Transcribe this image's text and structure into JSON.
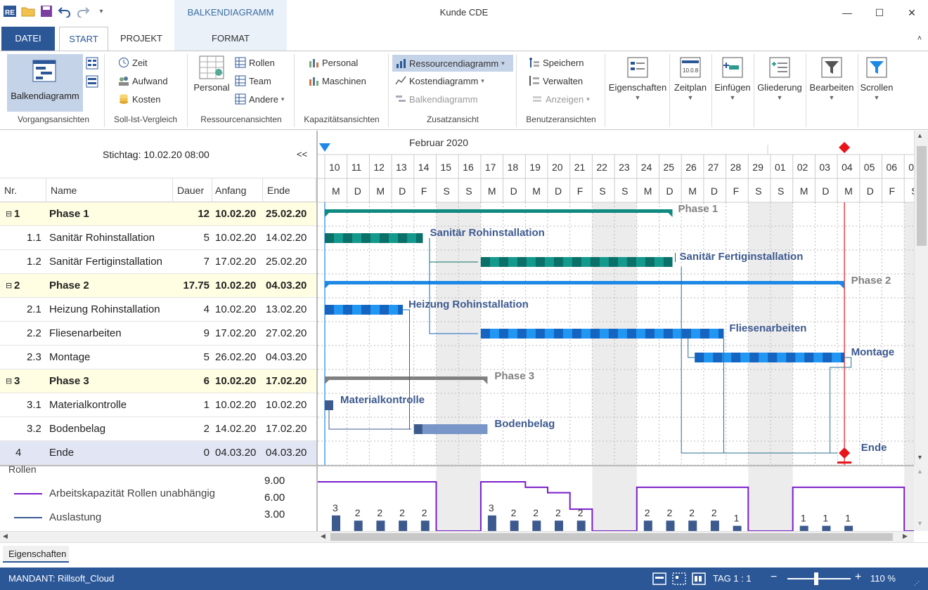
{
  "app": {
    "title": "Kunde CDE",
    "context_tab": "BALKENDIAGRAMM"
  },
  "tabs": [
    "DATEI",
    "START",
    "PROJEKT",
    "FORMAT"
  ],
  "ribbon": {
    "groups": {
      "vorgang": "Vorgangsansichten",
      "sollist": "Soll-Ist-Vergleich",
      "ressourcen": "Ressourcenansichten",
      "kapazitaet": "Kapazitätsansichten",
      "zusatz": "Zusatzansicht",
      "benutzer": "Benutzeransichten"
    },
    "balkendiagramm": "Balkendiagramm",
    "zeit": "Zeit",
    "aufwand": "Aufwand",
    "kosten": "Kosten",
    "personal": "Personal",
    "rollen": "Rollen",
    "team": "Team",
    "andere": "Andere",
    "kap_personal": "Personal",
    "maschinen": "Maschinen",
    "ressourcendiagramm": "Ressourcendiagramm",
    "kostendiagramm": "Kostendiagramm",
    "zusatz_balken": "Balkendiagramm",
    "speichern": "Speichern",
    "verwalten": "Verwalten",
    "anzeigen": "Anzeigen",
    "eigenschaften": "Eigenschaften",
    "zeitplan": "Zeitplan",
    "einfuegen": "Einfügen",
    "gliederung": "Gliederung",
    "bearbeiten": "Bearbeiten",
    "scrollen": "Scrollen",
    "zeitplan_icon_text": "10.0.8"
  },
  "table": {
    "stichtag": "Stichtag: 10.02.20 08:00",
    "collapse": "<<",
    "headers": {
      "nr": "Nr.",
      "name": "Name",
      "dauer": "Dauer",
      "anfang": "Anfang",
      "ende": "Ende"
    },
    "rows": [
      {
        "nr": "1",
        "name": "Phase 1",
        "dauer": "12",
        "anfang": "10.02.20",
        "ende": "25.02.20"
      },
      {
        "nr": "1.1",
        "name": "Sanitär Rohinstallation",
        "dauer": "5",
        "anfang": "10.02.20",
        "ende": "14.02.20"
      },
      {
        "nr": "1.2",
        "name": "Sanitär Fertiginstallation",
        "dauer": "7",
        "anfang": "17.02.20",
        "ende": "25.02.20"
      },
      {
        "nr": "2",
        "name": "Phase 2",
        "dauer": "17.75",
        "anfang": "10.02.20",
        "ende": "04.03.20"
      },
      {
        "nr": "2.1",
        "name": "Heizung Rohinstallation",
        "dauer": "4",
        "anfang": "10.02.20",
        "ende": "13.02.20"
      },
      {
        "nr": "2.2",
        "name": "Fliesenarbeiten",
        "dauer": "9",
        "anfang": "17.02.20",
        "ende": "27.02.20"
      },
      {
        "nr": "2.3",
        "name": "Montage",
        "dauer": "5",
        "anfang": "26.02.20",
        "ende": "04.03.20"
      },
      {
        "nr": "3",
        "name": "Phase 3",
        "dauer": "6",
        "anfang": "10.02.20",
        "ende": "17.02.20"
      },
      {
        "nr": "3.1",
        "name": "Materialkontrolle",
        "dauer": "1",
        "anfang": "10.02.20",
        "ende": "10.02.20"
      },
      {
        "nr": "3.2",
        "name": "Bodenbelag",
        "dauer": "2",
        "anfang": "14.02.20",
        "ende": "17.02.20"
      },
      {
        "nr": "4",
        "name": "Ende",
        "dauer": "0",
        "anfang": "04.03.20",
        "ende": "04.03.20"
      }
    ]
  },
  "timeline": {
    "month": "Februar 2020",
    "days": [
      "10",
      "11",
      "12",
      "13",
      "14",
      "15",
      "16",
      "17",
      "18",
      "19",
      "20",
      "21",
      "22",
      "23",
      "24",
      "25",
      "26",
      "27",
      "28",
      "29",
      "01",
      "02",
      "03",
      "04",
      "05",
      "06",
      "0"
    ],
    "weekdays": [
      "M",
      "D",
      "M",
      "D",
      "F",
      "S",
      "S",
      "M",
      "D",
      "M",
      "D",
      "F",
      "S",
      "S",
      "M",
      "D",
      "M",
      "D",
      "F",
      "S",
      "S",
      "M",
      "D",
      "M",
      "D",
      "F",
      "S"
    ],
    "weekend_days": [
      5,
      6,
      12,
      13,
      19,
      20,
      26
    ]
  },
  "gantt_labels": [
    "Phase 1",
    "Sanitär Rohinstallation",
    "Sanitär Fertiginstallation",
    "Phase 2",
    "Heizung Rohinstallation",
    "Fliesenarbeiten",
    "Montage",
    "Phase 3",
    "Materialkontrolle",
    "Bodenbelag",
    "Ende"
  ],
  "colors": {
    "teal": "#0e8a80",
    "blue": "#1e88e5",
    "gray": "#808080",
    "navy": "#3d5a8f",
    "purple": "#7a1fc9",
    "milestone": "#e8141a"
  },
  "legend": {
    "title": "Rollen",
    "kapazitaet": "Arbeitskapazität Rollen unabhängig",
    "auslastung": "Auslastung"
  },
  "chart_data": {
    "type": "bar",
    "ytick_labels": [
      "9.00",
      "6.00",
      "3.00"
    ],
    "ylim": [
      0,
      9
    ],
    "auslastung_values": [
      3,
      2,
      2,
      2,
      2,
      0,
      0,
      3,
      2,
      2,
      2,
      2,
      0,
      0,
      2,
      2,
      2,
      2,
      1,
      0,
      0,
      1,
      1,
      1,
      0,
      0,
      0
    ],
    "auslastung_labels": [
      "3",
      "2",
      "2",
      "2",
      "2",
      "",
      "",
      "3",
      "2",
      "2",
      "2",
      "2",
      "",
      "",
      "2",
      "2",
      "2",
      "2",
      "1",
      "",
      "",
      "1",
      "1",
      "1",
      "",
      "",
      ""
    ],
    "kapazitaet_values": [
      9,
      9,
      9,
      9,
      9,
      0,
      0,
      9,
      9,
      8,
      7,
      4,
      0,
      0,
      8,
      8,
      8,
      8,
      8,
      0,
      0,
      8,
      8,
      8,
      8,
      8,
      0
    ]
  },
  "properties": {
    "label": "Eigenschaften"
  },
  "status": {
    "mandant": "MANDANT: Rillsoft_Cloud",
    "tag": "TAG 1 : 1",
    "zoom": "110 %"
  }
}
